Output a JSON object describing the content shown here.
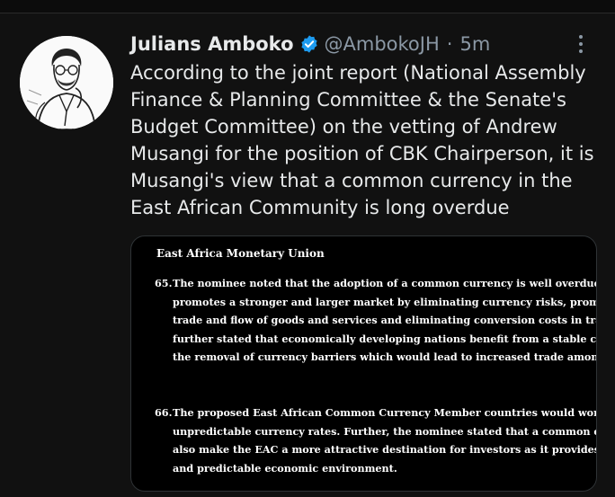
{
  "tweet": {
    "author": {
      "display_name": "Julians Amboko",
      "handle": "@AmbokoJH",
      "verified": true,
      "avatar_icon": "sketch-portrait"
    },
    "separator": "·",
    "time": "5m",
    "text": "According to the joint report (National Assembly Finance & Planning Committee & the Senate's Budget Committee) on the vetting of Andrew Musangi for the position of CBK Chairperson, it is Musangi's view that a common currency in the East African Community is long overdue",
    "more_icon": "more-vertical-icon",
    "colors": {
      "background": "#111111",
      "text": "#e7e9ea",
      "muted": "#8b98a5",
      "verified": "#1d9bf0"
    }
  },
  "document": {
    "title": "East Africa Monetary Union",
    "paragraphs": [
      {
        "number": "65.",
        "lines": [
          "The nominee noted that the adoption of a common currency is well overdue as it",
          "promotes a stronger and larger market by eliminating currency risks, promoting free",
          "trade and flow of goods and services and eliminating conversion costs in trade. He",
          "further stated that economically developing nations benefit from a stable currency and",
          "the removal of currency barriers which would lead to increased trade among nations."
        ]
      },
      {
        "number": "66.",
        "lines": [
          "The proposed East African Common Currency Member countries would worry about",
          "unpredictable currency rates. Further, the nominee stated that a common currency can",
          "also make the EAC a more attractive destination for investors as it provides a stable",
          "and predictable economic environment."
        ]
      }
    ]
  }
}
